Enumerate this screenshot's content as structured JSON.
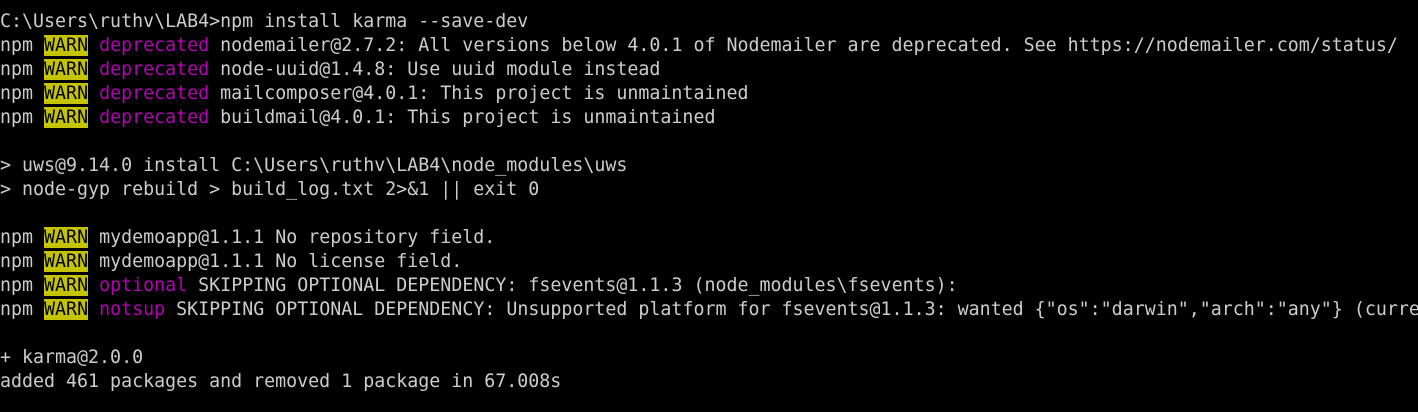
{
  "colors": {
    "background": "#000000",
    "text": "#cccccc",
    "warn_background": "#c4c400",
    "warn_text": "#000000",
    "tag_magenta": "#b600b6"
  },
  "terminal": {
    "command_line": "C:\\Users\\ruthv\\LAB4>npm install karma --save-dev",
    "npm_prefix": "npm",
    "warn_label": "WARN",
    "deprecations": [
      {
        "tag": "deprecated",
        "message": "nodemailer@2.7.2: All versions below 4.0.1 of Nodemailer are deprecated. See https://nodemailer.com/status/"
      },
      {
        "tag": "deprecated",
        "message": "node-uuid@1.4.8: Use uuid module instead"
      },
      {
        "tag": "deprecated",
        "message": "mailcomposer@4.0.1: This project is unmaintained"
      },
      {
        "tag": "deprecated",
        "message": "buildmail@4.0.1: This project is unmaintained"
      }
    ],
    "install_script": [
      "> uws@9.14.0 install C:\\Users\\ruthv\\LAB4\\node_modules\\uws",
      "> node-gyp rebuild > build_log.txt 2>&1 || exit 0"
    ],
    "warnings": [
      {
        "tag": "",
        "message": "mydemoapp@1.1.1 No repository field."
      },
      {
        "tag": "",
        "message": "mydemoapp@1.1.1 No license field."
      },
      {
        "tag": "optional",
        "message": "SKIPPING OPTIONAL DEPENDENCY: fsevents@1.1.3 (node_modules\\fsevents):"
      },
      {
        "tag": "notsup",
        "message": "SKIPPING OPTIONAL DEPENDENCY: Unsupported platform for fsevents@1.1.3: wanted {\"os\":\"darwin\",\"arch\":\"any\"} (curre"
      }
    ],
    "result_package": "+ karma@2.0.0",
    "summary": "added 461 packages and removed 1 package in 67.008s"
  }
}
